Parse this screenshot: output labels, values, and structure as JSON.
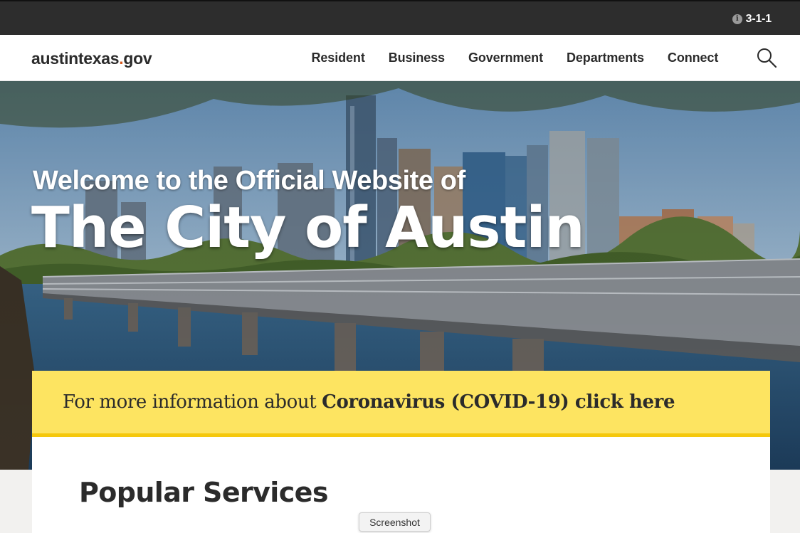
{
  "utility_bar": {
    "info_icon": "info-icon",
    "phone_311": "3-1-1"
  },
  "header": {
    "logo_main": "austintexas",
    "logo_dot": ".",
    "logo_tld": "gov",
    "nav": [
      {
        "label": "Resident"
      },
      {
        "label": "Business"
      },
      {
        "label": "Government"
      },
      {
        "label": "Departments"
      },
      {
        "label": "Connect"
      }
    ],
    "search_icon": "search-icon"
  },
  "hero": {
    "subtitle": "Welcome to the Official Website of",
    "title": "The City of Austin"
  },
  "covid_banner": {
    "prefix": "For more information about ",
    "link_text": "Coronavirus (COVID-19) click here"
  },
  "main": {
    "section_title": "Popular Services"
  },
  "tooltip": {
    "label": "Screenshot"
  },
  "colors": {
    "utility_bg": "#2d2d2d",
    "banner_yellow": "#fde461",
    "banner_border": "#f5c80c",
    "logo_dot": "#d65a1f"
  }
}
